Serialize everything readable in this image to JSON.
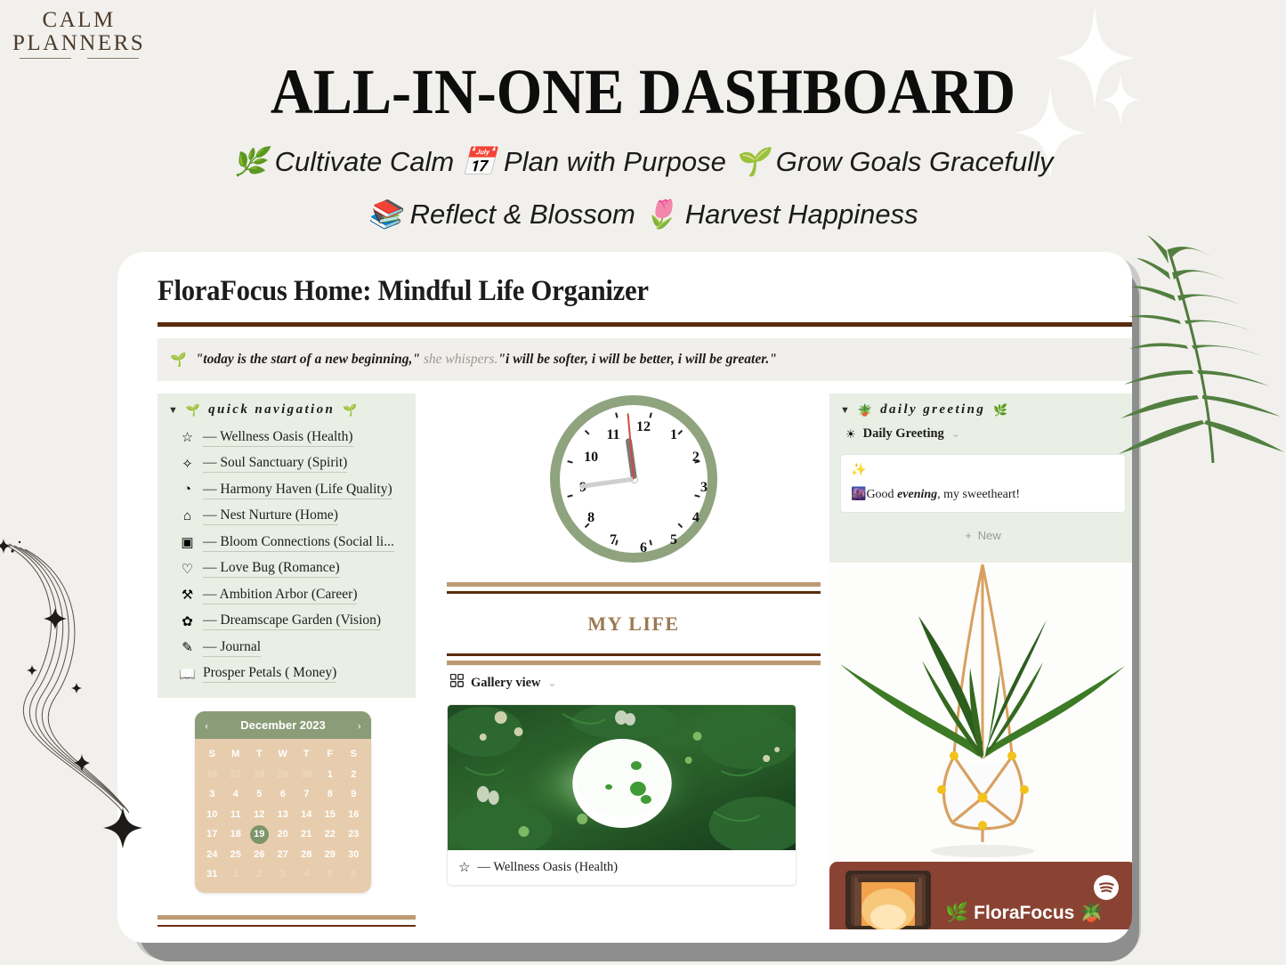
{
  "brand": {
    "line1": "CALM",
    "line2": "PLANNERS"
  },
  "header": {
    "headline": "ALL-IN-ONE DASHBOARD",
    "subline_1": "🌿 Cultivate Calm 📅 Plan with Purpose 🌱 Grow Goals Gracefully",
    "subline_2": "📚 Reflect & Blossom 🌷 Harvest Happiness"
  },
  "app": {
    "title": "FloraFocus Home:  Mindful Life Organizer",
    "quote_icon": "🌱",
    "quote_part1": "\"today is the start of a new beginning,\" ",
    "quote_soft": "she whispers.",
    "quote_part2": "\"i will be softer, i will be better, i will be greater.\""
  },
  "quick_nav": {
    "caret": "▼",
    "title": "quick navigation",
    "title_icon_left": "🌱",
    "title_icon_right": "🌱",
    "items": [
      {
        "icon": "☆",
        "label": "— Wellness Oasis (Health)"
      },
      {
        "icon": "✧",
        "label": "— Soul Sanctuary (Spirit)"
      },
      {
        "icon": "◔",
        "label": "— Harmony Haven (Life Quality)"
      },
      {
        "icon": "⌂",
        "label": "— Nest Nurture (Home)"
      },
      {
        "icon": "▣",
        "label": "— Bloom Connections (Social li..."
      },
      {
        "icon": "♡",
        "label": "— Love Bug (Romance)"
      },
      {
        "icon": "⚒",
        "label": "— Ambition Arbor (Career)"
      },
      {
        "icon": "✿",
        "label": "— Dreamscape Garden (Vision)"
      },
      {
        "icon": "✎",
        "label": "— Journal"
      },
      {
        "icon": "📖",
        "label": "Prosper Petals ( Money)"
      }
    ]
  },
  "calendar": {
    "month_label": "December 2023",
    "prev": "‹",
    "next": "›",
    "dow": [
      "S",
      "M",
      "T",
      "W",
      "T",
      "F",
      "S"
    ],
    "selected_day": 19,
    "weeks": [
      [
        {
          "d": "26",
          "mute": true
        },
        {
          "d": "27",
          "mute": true
        },
        {
          "d": "28",
          "mute": true
        },
        {
          "d": "29",
          "mute": true
        },
        {
          "d": "30",
          "mute": true
        },
        {
          "d": "1",
          "mute": false
        },
        {
          "d": "2",
          "mute": false
        }
      ],
      [
        {
          "d": "3",
          "mute": false
        },
        {
          "d": "4",
          "mute": false
        },
        {
          "d": "5",
          "mute": false
        },
        {
          "d": "6",
          "mute": false
        },
        {
          "d": "7",
          "mute": false
        },
        {
          "d": "8",
          "mute": false
        },
        {
          "d": "9",
          "mute": false
        }
      ],
      [
        {
          "d": "10",
          "mute": false
        },
        {
          "d": "11",
          "mute": false
        },
        {
          "d": "12",
          "mute": false
        },
        {
          "d": "13",
          "mute": false
        },
        {
          "d": "14",
          "mute": false
        },
        {
          "d": "15",
          "mute": false
        },
        {
          "d": "16",
          "mute": false
        }
      ],
      [
        {
          "d": "17",
          "mute": false
        },
        {
          "d": "18",
          "mute": false
        },
        {
          "d": "19",
          "mute": false
        },
        {
          "d": "20",
          "mute": false
        },
        {
          "d": "21",
          "mute": false
        },
        {
          "d": "22",
          "mute": false
        },
        {
          "d": "23",
          "mute": false
        }
      ],
      [
        {
          "d": "24",
          "mute": false
        },
        {
          "d": "25",
          "mute": false
        },
        {
          "d": "26",
          "mute": false
        },
        {
          "d": "27",
          "mute": false
        },
        {
          "d": "28",
          "mute": false
        },
        {
          "d": "29",
          "mute": false
        },
        {
          "d": "30",
          "mute": false
        }
      ],
      [
        {
          "d": "31",
          "mute": false
        },
        {
          "d": "1",
          "mute": true
        },
        {
          "d": "2",
          "mute": true
        },
        {
          "d": "3",
          "mute": true
        },
        {
          "d": "4",
          "mute": true
        },
        {
          "d": "5",
          "mute": true
        },
        {
          "d": "6",
          "mute": true
        }
      ]
    ]
  },
  "clock": {
    "numbers": [
      "12",
      "1",
      "2",
      "3",
      "4",
      "5",
      "6",
      "7",
      "8",
      "9",
      "10",
      "11"
    ],
    "hour_deg": 352,
    "minute_deg": 262,
    "second_deg": 355
  },
  "middle": {
    "section_title": "MY LIFE",
    "gallery_view_label": "Gallery view",
    "gallery_chevron": "⌄",
    "gallery_card_icon": "☆",
    "gallery_card_label": "— Wellness Oasis (Health)"
  },
  "daily_greeting": {
    "caret": "▼",
    "title": "daily greeting",
    "title_icon_left": "🪴",
    "title_icon_right": "🌿",
    "sub_icon": "☀",
    "sub_label": "Daily Greeting",
    "sub_chevron": "⌄",
    "card_sparkle": "✨",
    "msg_icon": "🌆",
    "msg_pre": "Good ",
    "msg_em": "evening",
    "msg_post": ", my sweetheart!",
    "new_plus": "+",
    "new_label": "New"
  },
  "spotify": {
    "title": "FloraFocus",
    "leaf_left": "🌿",
    "leaf_right": "🪴"
  },
  "colors": {
    "page_bg": "#f2f0ec",
    "accent_brown": "#5a2d0c",
    "accent_tan": "#bc9a73",
    "sage": "#8a9d78",
    "panel_green": "#eaefe5",
    "spotify_maroon": "#8a4233",
    "mylife_text": "#9b7a52"
  }
}
